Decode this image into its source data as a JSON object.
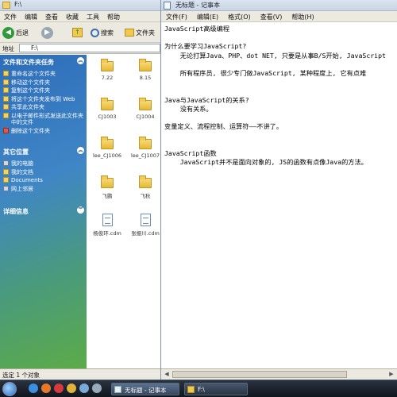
{
  "explorer": {
    "title": "F:\\",
    "menu": [
      "文件",
      "编辑",
      "查看",
      "收藏",
      "工具",
      "帮助"
    ],
    "toolbar": {
      "back": "后退",
      "search": "搜索",
      "folders": "文件夹"
    },
    "address_label": "地址",
    "address_value": "F:\\",
    "file_tasks": {
      "title": "文件和文件夹任务",
      "items": [
        "重命名这个文件夹",
        "移动这个文件夹",
        "复制这个文件夹",
        "将这个文件夹发布到 Web",
        "共享此文件夹",
        "以电子邮件形式发送此文件夹中的文件",
        "删除这个文件夹"
      ]
    },
    "other_places": {
      "title": "其它位置",
      "items": [
        "我的电脑",
        "我的文档",
        "Documents",
        "网上邻居"
      ]
    },
    "details": {
      "title": "详细信息"
    },
    "files": [
      {
        "name": "7.22",
        "kind": "folder"
      },
      {
        "name": "8.15",
        "kind": "folder"
      },
      {
        "name": "CJ1003",
        "kind": "folder"
      },
      {
        "name": "CJ1004",
        "kind": "folder"
      },
      {
        "name": "lee_CJ1006",
        "kind": "folder"
      },
      {
        "name": "lee_CJ1007",
        "kind": "folder"
      },
      {
        "name": "飞鹏",
        "kind": "folder"
      },
      {
        "name": "飞秋",
        "kind": "folder"
      },
      {
        "name": "杨俊环.cdm",
        "kind": "doc"
      },
      {
        "name": "张振川.cdm",
        "kind": "doc"
      }
    ],
    "status": "选定 1 个对象"
  },
  "notepad": {
    "title": "无标题 - 记事本",
    "menu": [
      "文件(F)",
      "编辑(E)",
      "格式(O)",
      "查看(V)",
      "帮助(H)"
    ],
    "lines": [
      "JavaScript高级编程",
      "",
      "为什么要学习JavaScript?",
      "    无论打算Java、PHP、dot NET, 只要是从事B/S开始, JavaScript",
      "",
      "    所有程序员, 很少专门做JavaScript, 某种程度上, 它有点难",
      "",
      "",
      "Java与JavaScript的关系?",
      "    没有关系。",
      "",
      "变量定义、流程控制、运算符——不讲了。",
      "",
      "",
      "JavaScript函数",
      "    JavaScript并不是面向对象的, JS的函数有点像Java的方法。",
      "",
      ""
    ]
  },
  "taskbar": {
    "buttons": [
      "无标题 - 记事本",
      "F:\\"
    ]
  },
  "colors": {
    "sidebar_top": "#2d6dba",
    "sidebar_bottom": "#5cab48",
    "taskbar": "#1a222c"
  }
}
